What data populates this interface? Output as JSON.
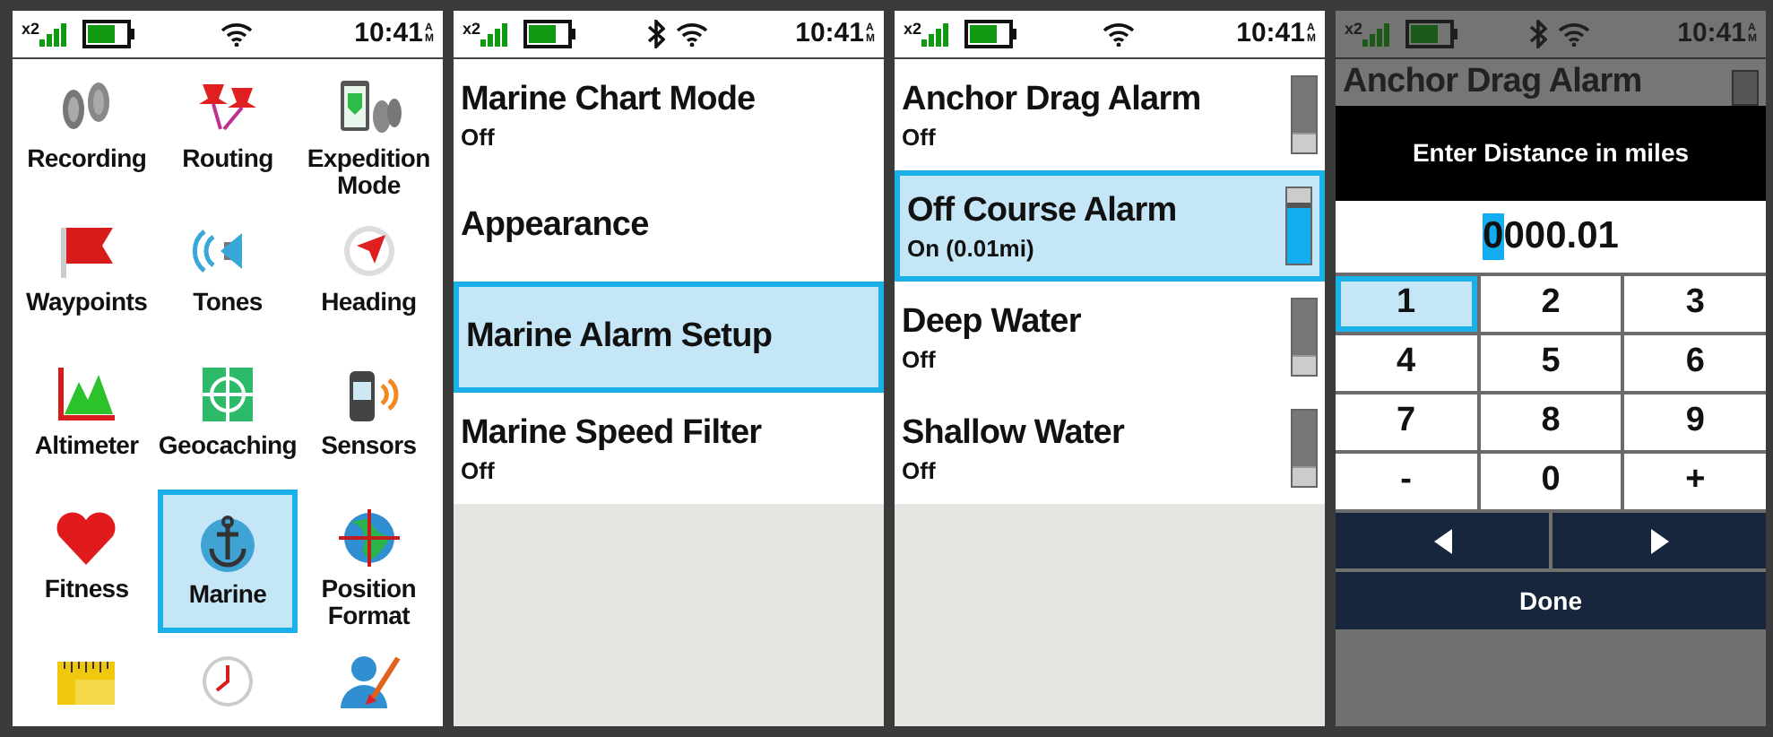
{
  "screens": [
    {
      "kind": "grid",
      "status": {
        "signal_label": "x2",
        "bluetooth": false,
        "time": "10:41",
        "am_top": "A",
        "am_bottom": "M"
      },
      "items": [
        {
          "kind": "footprints",
          "label": "Recording",
          "selected": false
        },
        {
          "kind": "pushpins",
          "label": "Routing",
          "selected": false
        },
        {
          "kind": "battery-shield",
          "label": "Expedition Mode",
          "selected": false
        },
        {
          "kind": "flag",
          "label": "Waypoints",
          "selected": false
        },
        {
          "kind": "speaker",
          "label": "Tones",
          "selected": false
        },
        {
          "kind": "compass",
          "label": "Heading",
          "selected": false
        },
        {
          "kind": "mountains",
          "label": "Altimeter",
          "selected": false
        },
        {
          "kind": "geocache",
          "label": "Geocaching",
          "selected": false
        },
        {
          "kind": "device",
          "label": "Sensors",
          "selected": false
        },
        {
          "kind": "heart",
          "label": "Fitness",
          "selected": false
        },
        {
          "kind": "anchor",
          "label": "Marine",
          "selected": true
        },
        {
          "kind": "globe",
          "label": "Position Format",
          "selected": false
        },
        {
          "kind": "ruler",
          "selected": false
        },
        {
          "kind": "clock",
          "selected": false
        },
        {
          "kind": "person",
          "selected": false
        }
      ]
    },
    {
      "kind": "list",
      "status": {
        "signal_label": "x2",
        "bluetooth": true,
        "time": "10:41",
        "am_top": "A",
        "am_bottom": "M"
      },
      "items": [
        {
          "title": "Marine Chart Mode",
          "value": "Off",
          "selected": false
        },
        {
          "title": "Appearance",
          "selected": false
        },
        {
          "title": "Marine Alarm Setup",
          "selected": true
        },
        {
          "title": "Marine Speed Filter",
          "value": "Off",
          "selected": false
        }
      ]
    },
    {
      "kind": "toggles",
      "status": {
        "signal_label": "x2",
        "bluetooth": false,
        "time": "10:41",
        "am_top": "A",
        "am_bottom": "M"
      },
      "items": [
        {
          "title": "Anchor Drag Alarm",
          "value": "Off",
          "selected": false,
          "on": false
        },
        {
          "title": "Off Course Alarm",
          "value": "On (0.01mi)",
          "selected": true,
          "on": true
        },
        {
          "title": "Deep Water",
          "value": "Off",
          "selected": false,
          "on": false
        },
        {
          "title": "Shallow Water",
          "value": "Off",
          "selected": false,
          "on": false
        }
      ]
    },
    {
      "kind": "keypad",
      "status": {
        "signal_label": "x2",
        "bluetooth": true,
        "time": "10:41",
        "am_top": "A",
        "am_bottom": "M"
      },
      "behind_title": "Anchor Drag Alarm",
      "behind_on": false,
      "dialog": {
        "title": "Enter Distance in miles",
        "cursor_text": "0",
        "after_cursor": "000.01",
        "keys": [
          {
            "label": "1",
            "selected": true
          },
          {
            "label": "2",
            "selected": false
          },
          {
            "label": "3",
            "selected": false
          },
          {
            "label": "4",
            "selected": false
          },
          {
            "label": "5",
            "selected": false
          },
          {
            "label": "6",
            "selected": false
          },
          {
            "label": "7",
            "selected": false
          },
          {
            "label": "8",
            "selected": false
          },
          {
            "label": "9",
            "selected": false
          },
          {
            "label": "-",
            "selected": false
          },
          {
            "label": "0",
            "selected": false
          },
          {
            "label": "+",
            "selected": false
          }
        ],
        "done": "Done"
      }
    }
  ]
}
